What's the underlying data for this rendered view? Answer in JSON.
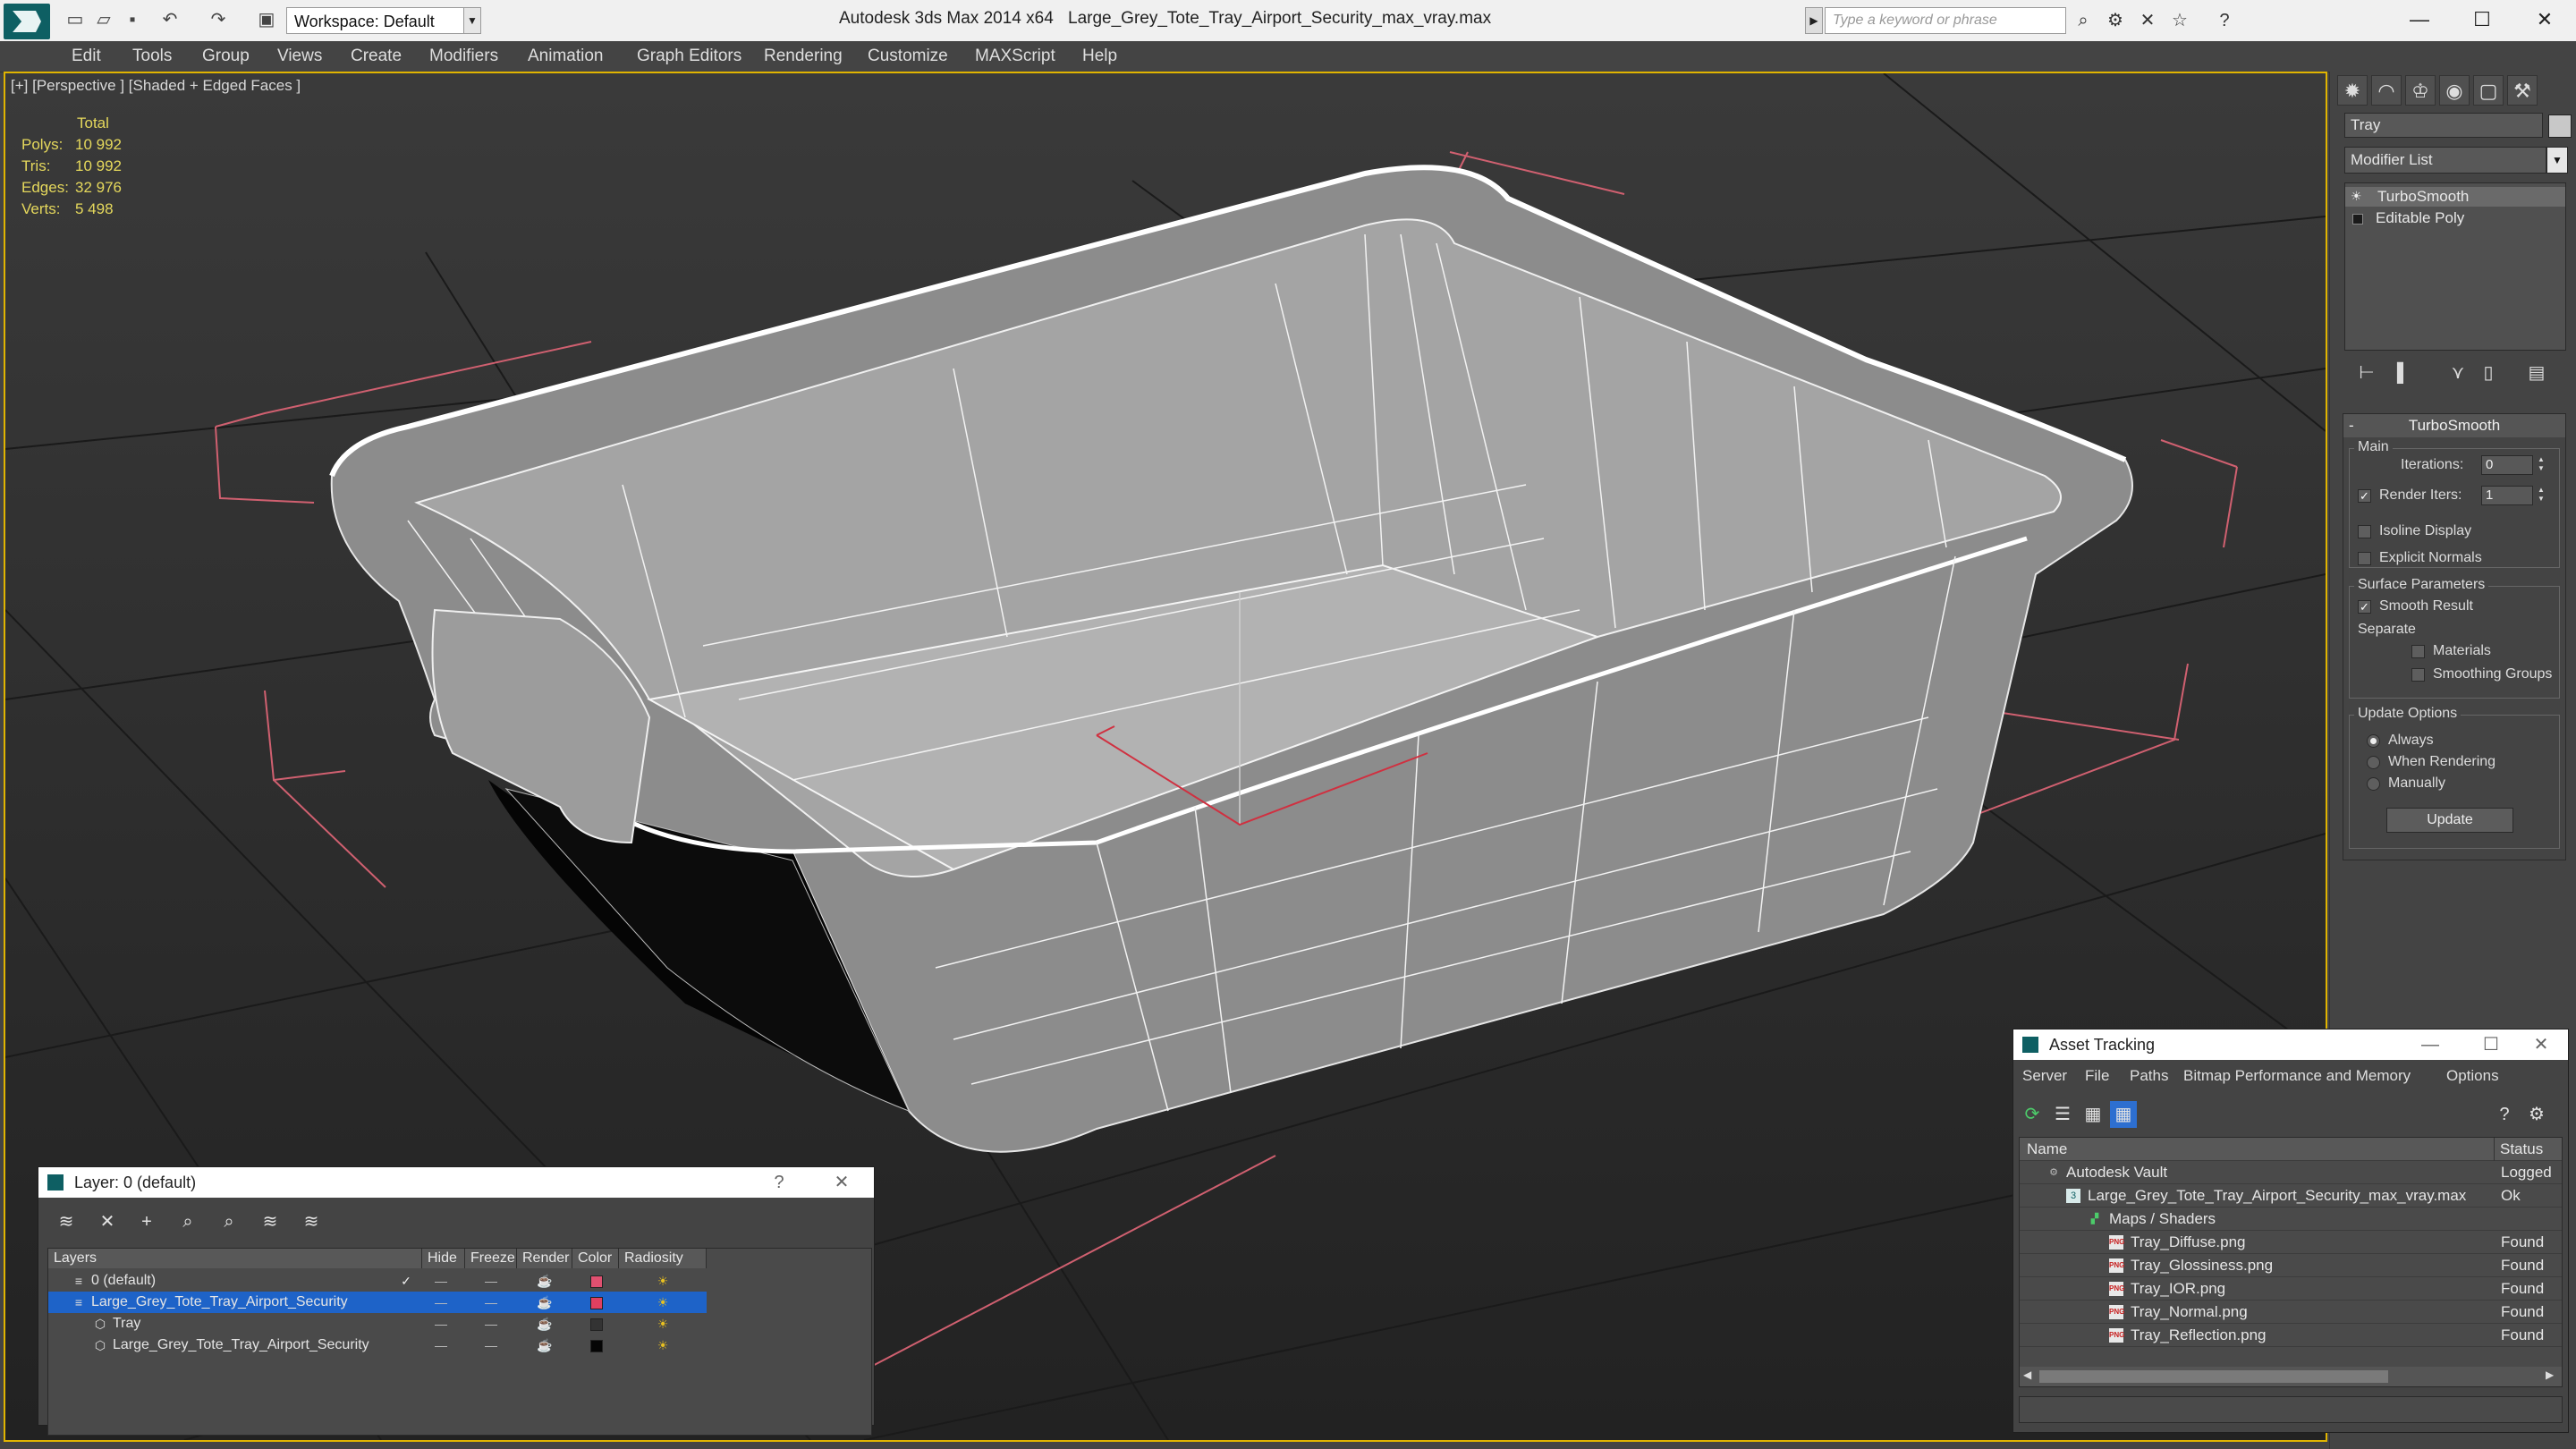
{
  "titlebar": {
    "workspace": "Workspace: Default",
    "app_title": "Autodesk 3ds Max  2014 x64",
    "file_title": "Large_Grey_Tote_Tray_Airport_Security_max_vray.max",
    "search_placeholder": "Type a keyword or phrase",
    "minimize": "—",
    "maximize": "☐",
    "close": "✕"
  },
  "menu": [
    "Edit",
    "Tools",
    "Group",
    "Views",
    "Create",
    "Modifiers",
    "Animation",
    "Graph Editors",
    "Rendering",
    "Customize",
    "MAXScript",
    "Help"
  ],
  "viewport": {
    "label": "[+] [Perspective ] [Shaded + Edged Faces ]",
    "stats": {
      "header": "Total",
      "rows": [
        {
          "label": "Polys:",
          "value": "10 992"
        },
        {
          "label": "Tris:",
          "value": "10 992"
        },
        {
          "label": "Edges:",
          "value": "32 976"
        },
        {
          "label": "Verts:",
          "value": "5 498"
        }
      ]
    }
  },
  "command_panel": {
    "object_name": "Tray",
    "modifier_list": "Modifier List",
    "stack": [
      "TurboSmooth",
      "Editable Poly"
    ],
    "turbosmooth": {
      "title": "TurboSmooth",
      "main_group": "Main",
      "iterations_label": "Iterations:",
      "iterations_value": "0",
      "render_iters_label": "Render Iters:",
      "render_iters_value": "1",
      "render_iters_checked": true,
      "isoline_label": "Isoline Display",
      "explicit_label": "Explicit Normals",
      "surface_group": "Surface Parameters",
      "smooth_result_label": "Smooth Result",
      "separate_label": "Separate",
      "materials_label": "Materials",
      "smoothing_groups_label": "Smoothing Groups",
      "update_group": "Update Options",
      "always_label": "Always",
      "when_rendering_label": "When Rendering",
      "manually_label": "Manually",
      "update_button": "Update"
    }
  },
  "layer_window": {
    "title": "Layer: 0 (default)",
    "help": "?",
    "close": "✕",
    "columns": [
      "Layers",
      "Hide",
      "Freeze",
      "Render",
      "Color",
      "Radiosity"
    ],
    "rows": [
      {
        "name": "0 (default)",
        "color": "#e05070"
      },
      {
        "name": "Large_Grey_Tote_Tray_Airport_Security",
        "color": "#e04060"
      },
      {
        "name": "Tray",
        "color": "#333333"
      },
      {
        "name": "Large_Grey_Tote_Tray_Airport_Security",
        "color": "#050505"
      }
    ]
  },
  "asset_window": {
    "title": "Asset Tracking",
    "menu": [
      "Server",
      "File",
      "Paths",
      "Bitmap Performance and Memory",
      "Options"
    ],
    "col_name": "Name",
    "col_status": "Status",
    "rows": [
      {
        "name": "Autodesk Vault",
        "status": "Logged"
      },
      {
        "name": "Large_Grey_Tote_Tray_Airport_Security_max_vray.max",
        "status": "Ok"
      },
      {
        "name": "Maps / Shaders",
        "status": ""
      },
      {
        "name": "Tray_Diffuse.png",
        "status": "Found"
      },
      {
        "name": "Tray_Glossiness.png",
        "status": "Found"
      },
      {
        "name": "Tray_IOR.png",
        "status": "Found"
      },
      {
        "name": "Tray_Normal.png",
        "status": "Found"
      },
      {
        "name": "Tray_Reflection.png",
        "status": "Found"
      }
    ]
  },
  "colors": {
    "accent_yellow": "#e0b400",
    "selection_blue": "#1e63c8",
    "stats_yellow": "#e5d85c"
  }
}
